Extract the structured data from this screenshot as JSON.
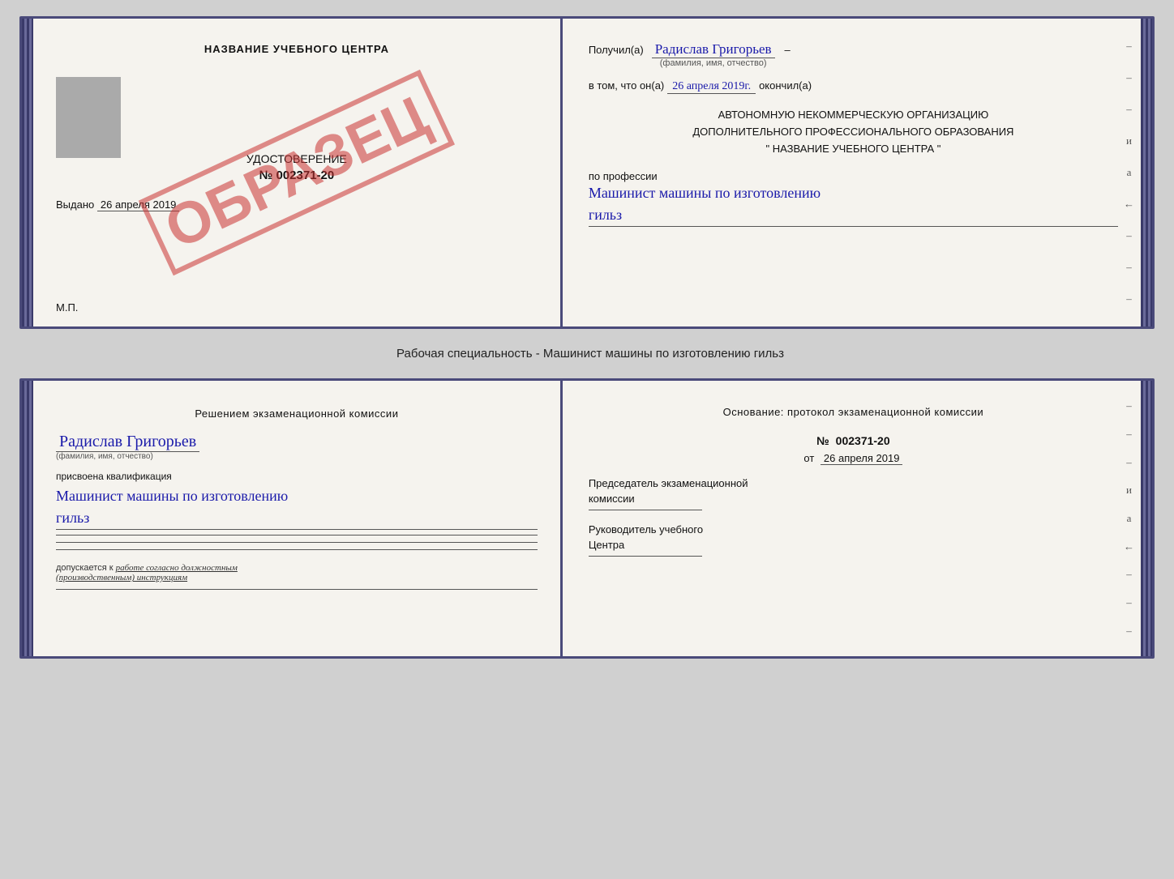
{
  "top_doc": {
    "left": {
      "institution_name": "НАЗВАНИЕ УЧЕБНОГО ЦЕНТРА",
      "photo_placeholder": true,
      "watermark": "ОБРАЗЕЦ",
      "cert_title": "УДОСТОВЕРЕНИЕ",
      "cert_number": "№ 002371-20",
      "issued_label": "Выдано",
      "issued_date": "26 апреля 2019",
      "mp_label": "М.П."
    },
    "right": {
      "received_label": "Получил(а)",
      "recipient_name": "Радислав Григорьев",
      "fio_note": "(фамилия, имя, отчество)",
      "in_that_label": "в том, что он(а)",
      "completion_date": "26 апреля 2019г.",
      "finished_label": "окончил(а)",
      "org_line1": "АВТОНОМНУЮ НЕКОММЕРЧЕСКУЮ ОРГАНИЗАЦИЮ",
      "org_line2": "ДОПОЛНИТЕЛЬНОГО ПРОФЕССИОНАЛЬНОГО ОБРАЗОВАНИЯ",
      "org_quote_open": "\"",
      "org_name": "НАЗВАНИЕ УЧЕБНОГО ЦЕНТРА",
      "org_quote_close": "\"",
      "profession_label": "по профессии",
      "profession_handwritten": "Машинист машины по изготовлению",
      "profession_handwritten2": "гильз",
      "margin_dashes": [
        "-",
        "-",
        "-",
        "и",
        "а",
        "←",
        "-",
        "-",
        "-"
      ]
    }
  },
  "section_label": "Рабочая специальность - Машинист машины по изготовлению гильз",
  "bottom_doc": {
    "left": {
      "decision_text": "Решением  экзаменационной  комиссии",
      "person_name": "Радислав Григорьев",
      "fio_note": "(фамилия, имя, отчество)",
      "assigned_label": "присвоена квалификация",
      "qualification_handwritten": "Машинист машины по изготовлению",
      "qualification_handwritten2": "гильз",
      "underlines": [
        "",
        "",
        "",
        ""
      ],
      "allow_text": "допускается к",
      "allow_italic": "работе согласно должностным",
      "allow_italic2": "(производственным) инструкциям",
      "bottom_underline": ""
    },
    "right": {
      "basis_text": "Основание: протокол экзаменационной  комиссии",
      "number_label": "№",
      "number_value": "002371-20",
      "date_prefix": "от",
      "date_value": "26 апреля 2019",
      "chairman_label": "Председатель экзаменационной",
      "chairman_label2": "комиссии",
      "head_label": "Руководитель учебного",
      "head_label2": "Центра",
      "margin_dashes": [
        "-",
        "-",
        "-",
        "и",
        "а",
        "←",
        "-",
        "-",
        "-"
      ]
    }
  }
}
